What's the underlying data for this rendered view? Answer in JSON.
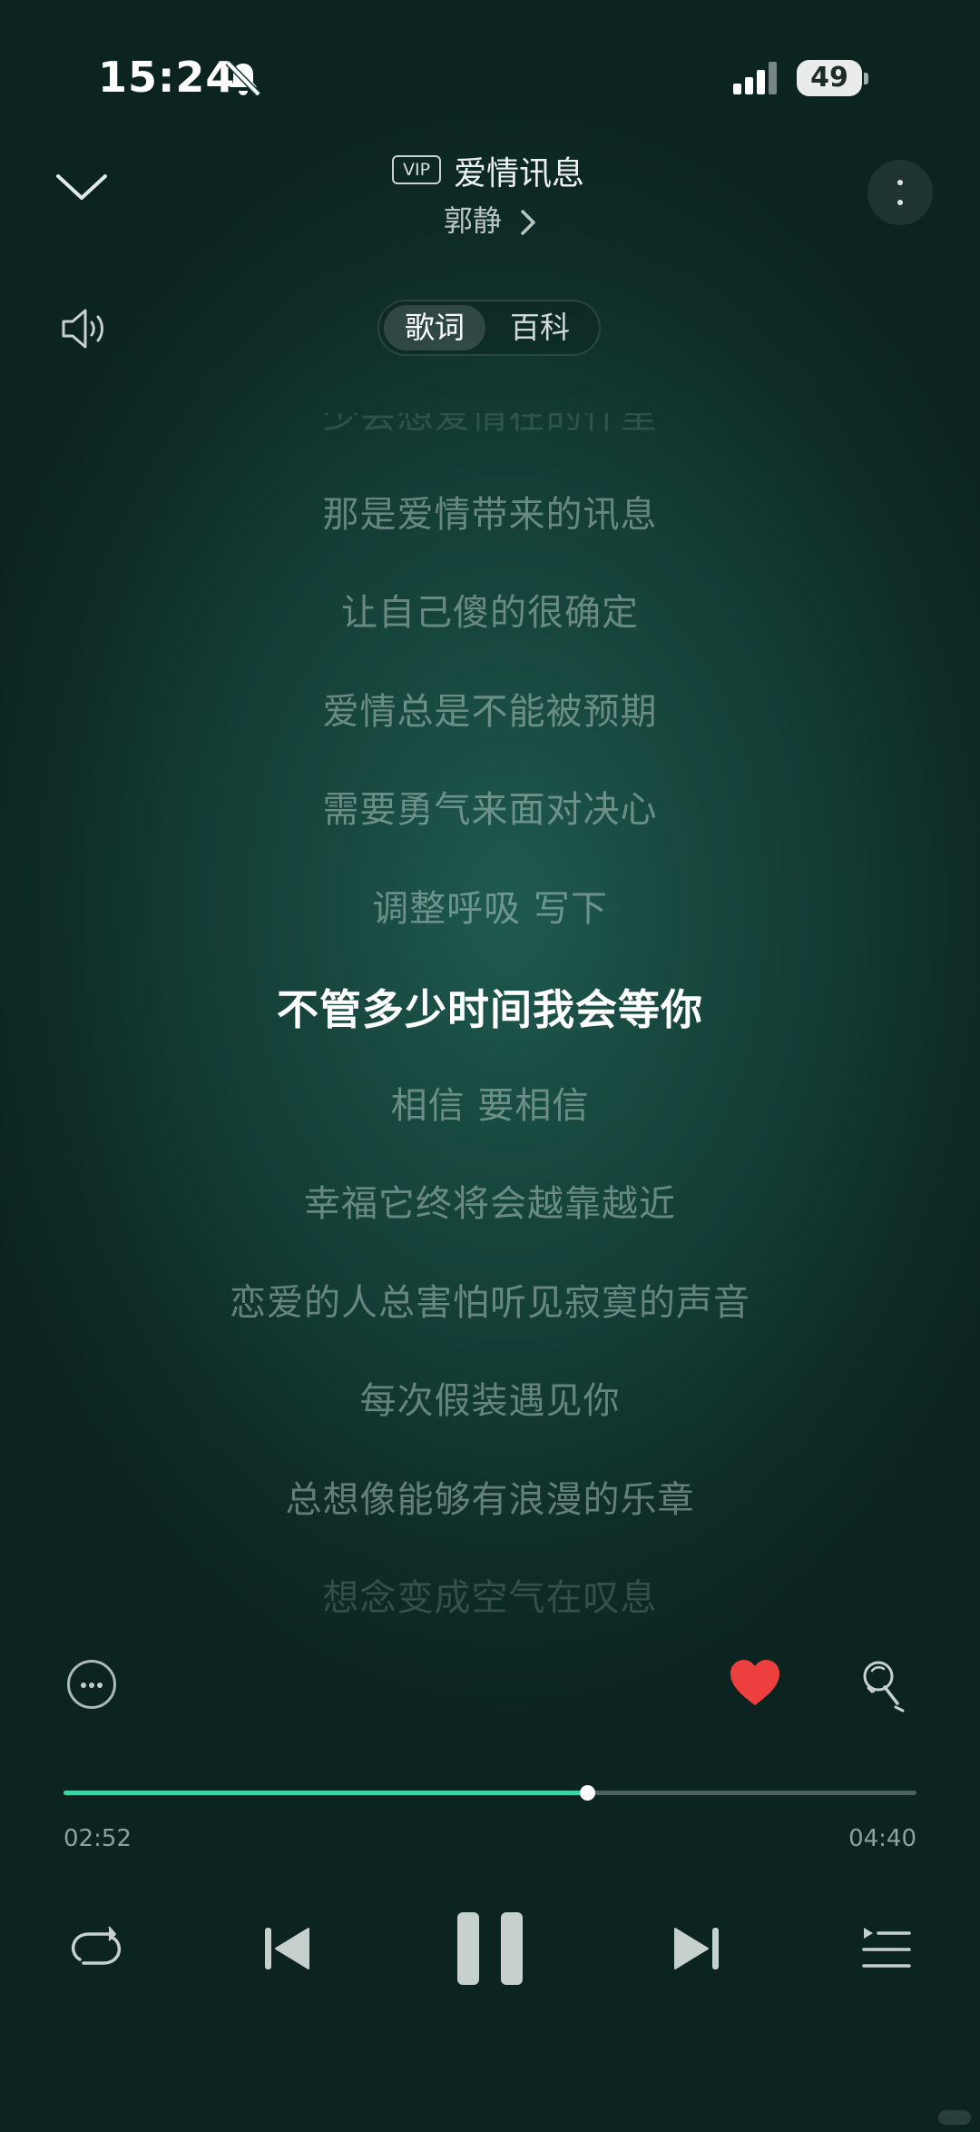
{
  "status_bar": {
    "time": "15:24",
    "battery": "49",
    "battery_level_percent": 49
  },
  "header": {
    "vip_badge": "VIP",
    "song_title": "爱情讯息",
    "artist": "郭静",
    "collapse_icon": "chevron-down-icon",
    "more_icon": "vertical-dots-icon"
  },
  "tabs": [
    {
      "label": "歌词",
      "active": true
    },
    {
      "label": "百科",
      "active": false
    }
  ],
  "lyrics": {
    "lines": [
      "少会想爱情在的什里",
      "那是爱情带来的讯息",
      "让自己傻的很确定",
      "爱情总是不能被预期",
      "需要勇气来面对决心",
      "调整呼吸 写下",
      "不管多少时间我会等你",
      "相信 要相信",
      "幸福它终将会越靠越近",
      "恋爱的人总害怕听见寂寞的声音",
      "每次假装遇见你",
      "总想像能够有浪漫的乐章",
      "想念变成空气在叹息"
    ],
    "current_index": 6
  },
  "actions": {
    "more_icon": "more-horizontal-icon",
    "like_icon": "heart-icon",
    "liked": true,
    "sing_icon": "microphone-icon",
    "accent_color": "#ee3f3f"
  },
  "playback": {
    "current_time": "02:52",
    "total_time": "04:40",
    "progress_fraction": 0.614,
    "progress_color": "#3ed2a8"
  },
  "controls": {
    "repeat_icon": "repeat-icon",
    "previous_icon": "skip-previous-icon",
    "pause_icon": "pause-icon",
    "next_icon": "skip-next-icon",
    "playlist_icon": "playlist-icon"
  }
}
